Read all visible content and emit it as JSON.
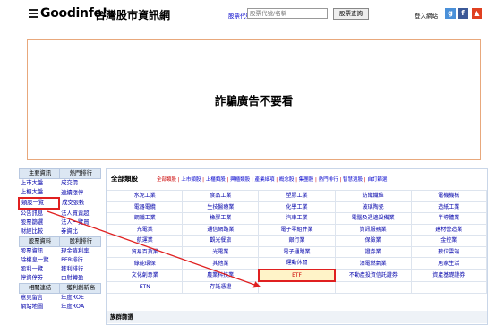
{
  "header": {
    "logo": "Goodinfo!",
    "subtitle": "台灣股市資訊網",
    "stock_label": "股票代號/名稱",
    "search_placeholder": "股票代號/名稱",
    "search_button": "股票查詢",
    "login": "登入網站"
  },
  "ad": {
    "text": "詐騙廣告不要看"
  },
  "left_nav": {
    "rows": [
      [
        "主要資訊",
        "熱門排行"
      ],
      [
        "上市大盤",
        "成交價"
      ],
      [
        "上櫃大盤",
        "連續漲停"
      ],
      [
        "類股一覽",
        "成交張數"
      ],
      [
        "公告訊息",
        "法人買賣超"
      ],
      [
        "股票篩選",
        "法人一覽買"
      ],
      [
        "財經比較",
        "券資比"
      ],
      [
        "股票資料",
        "股利排行"
      ],
      [
        "股票資訊",
        "現金殖利率"
      ],
      [
        "除權息一覽",
        "PER排行"
      ],
      [
        "股利一覽",
        "獲利排行"
      ],
      [
        "停資停券",
        "由射轉盈"
      ],
      [
        "相關連結",
        "獲利創新高"
      ],
      [
        "意見留言",
        "年度ROE"
      ],
      [
        "網站地圖",
        "年度ROA"
      ]
    ]
  },
  "panel": {
    "title": "全部類股",
    "category_links": [
      "全部類股",
      "上市類股",
      "上櫃類股",
      "興櫃類股",
      "產業細項",
      "概念股",
      "集團股",
      "熱門排行",
      "智慧選股",
      "自訂篩選"
    ],
    "grid": [
      [
        "水泥工業",
        "食品工業",
        "塑膠工業",
        "紡織纖維",
        "電機機械"
      ],
      [
        "電器電纜",
        "生技醫療業",
        "化學工業",
        "玻璃陶瓷",
        "造紙工業"
      ],
      [
        "鋼鐵工業",
        "橡膠工業",
        "汽車工業",
        "電腦及週邊設備業",
        "半導體業"
      ],
      [
        "光電業",
        "通信網路業",
        "電子零組件業",
        "資訊服務業",
        "建材營造業"
      ],
      [
        "航運業",
        "觀光餐旅",
        "銀行業",
        "保險業",
        "金控業"
      ],
      [
        "貿易百貨業",
        "光電業",
        "電子通路業",
        "證券業",
        "數位雲端"
      ],
      [
        "綠能環保",
        "其他業",
        "運動休閒",
        "油電燃氣業",
        "居家生活"
      ],
      [
        "文化創意業",
        "農業科技業",
        "ETF",
        "不動產投資信託證券",
        "資產基礎證券"
      ],
      [
        "ETN",
        "存託憑證",
        "",
        "",
        ""
      ]
    ],
    "group_bar": "族群篩選"
  },
  "colors": {
    "highlight": "#e02020",
    "link": "#0000aa",
    "accent": "#cc0000"
  }
}
